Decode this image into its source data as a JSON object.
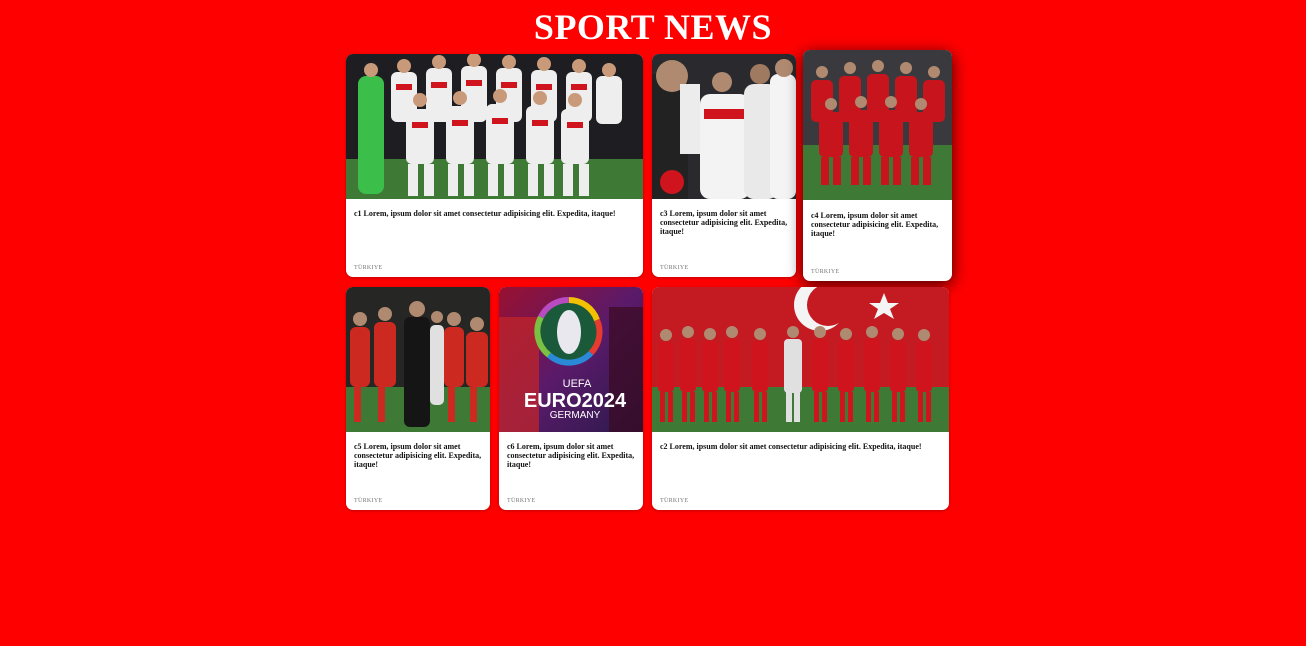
{
  "header": {
    "title": "SPORT NEWS"
  },
  "cards": [
    {
      "id": "c1",
      "text": "c1 Lorem, ipsum dolor sit amet consectetur adipisicing elit. Expedita, itaque!",
      "tag": "TÜRKIYE",
      "image": "turkey-team-photo"
    },
    {
      "id": "c3",
      "text": "c3 Lorem, ipsum dolor sit amet consectetur adipisicing elit. Expedita, itaque!",
      "tag": "TÜRKIYE",
      "image": "team-celebration"
    },
    {
      "id": "c4",
      "text": "c4 Lorem, ipsum dolor sit amet consectetur adipisicing elit. Expedita, itaque!",
      "tag": "TÜRKIYE",
      "image": "team-red-kit"
    },
    {
      "id": "c5",
      "text": "c5 Lorem, ipsum dolor sit amet consectetur adipisicing elit. Expedita, itaque!",
      "tag": "TÜRKIYE",
      "image": "fans-celebration"
    },
    {
      "id": "c6",
      "text": "c6 Lorem, ipsum dolor sit amet consectetur adipisicing elit. Expedita, itaque!",
      "tag": "TÜRKIYE",
      "image": "euro2024-poster",
      "poster": {
        "line1": "UEFA",
        "line2": "EURO2024",
        "line3": "GERMANY"
      }
    },
    {
      "id": "c2",
      "text": "c2 Lorem, ipsum dolor sit amet consectetur adipisicing elit. Expedita, itaque!",
      "tag": "TÜRKIYE",
      "image": "team-lineup-flag"
    }
  ],
  "colors": {
    "background": "#ff0000",
    "card": "#ffffff",
    "kit_red": "#d0141e",
    "kit_white": "#f2f2f2",
    "pitch": "#3e7a36"
  }
}
